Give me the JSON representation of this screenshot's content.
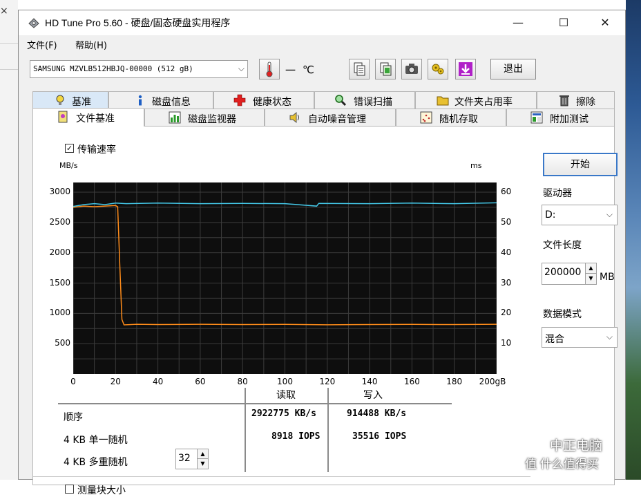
{
  "window": {
    "title": "HD Tune Pro 5.60 - 硬盘/固态硬盘实用程序",
    "minimize": "—",
    "maximize": "☐",
    "close": "✕"
  },
  "menu": [
    "文件(F)",
    "帮助(H)"
  ],
  "toolbar": {
    "drive": "SAMSUNG MZVLB512HBJQ-00000 (512 gB)",
    "temperature": "一",
    "exit_label": "退出",
    "icons": [
      "thermometer-icon",
      "copy-text-icon",
      "copy-screen-icon",
      "camera-icon",
      "options-icon",
      "save-download-icon"
    ]
  },
  "tabs_row1": [
    "基准",
    "磁盘信息",
    "健康状态",
    "错误扫描",
    "文件夹占用率",
    "擦除"
  ],
  "tabs_row2": [
    "文件基准",
    "磁盘监视器",
    "自动噪音管理",
    "随机存取",
    "附加测试"
  ],
  "active_tab": "文件基准",
  "benchmark": {
    "transfer_rate_label": "传输速率",
    "transfer_rate_checked": true,
    "block_size_label": "测量块大小",
    "block_size_checked": false
  },
  "chart_data": {
    "type": "line",
    "xlabel": "gB",
    "ylabel_left": "MB/s",
    "ylabel_right": "ms",
    "x_ticks": [
      0,
      20,
      40,
      60,
      80,
      100,
      120,
      140,
      160,
      180,
      200
    ],
    "x_tick_labels": [
      "0",
      "20",
      "40",
      "60",
      "80",
      "100",
      "120",
      "140",
      "160",
      "180",
      "200gB"
    ],
    "y_left_ticks": [
      500,
      1000,
      1500,
      2000,
      2500,
      3000
    ],
    "y_right_ticks": [
      10,
      20,
      30,
      40,
      50,
      60
    ],
    "xlim": [
      0,
      200
    ],
    "ylim_left": [
      0,
      3000
    ],
    "ylim_right": [
      0,
      60
    ],
    "grid": true,
    "series": [
      {
        "color": "#ff8c1a",
        "axis": "left",
        "points": [
          [
            0,
            2750
          ],
          [
            5,
            2770
          ],
          [
            10,
            2760
          ],
          [
            15,
            2770
          ],
          [
            20,
            2780
          ],
          [
            21,
            2760
          ],
          [
            22,
            1800
          ],
          [
            23,
            900
          ],
          [
            24,
            810
          ],
          [
            30,
            820
          ],
          [
            40,
            815
          ],
          [
            60,
            820
          ],
          [
            80,
            815
          ],
          [
            100,
            818
          ],
          [
            120,
            812
          ],
          [
            140,
            815
          ],
          [
            160,
            818
          ],
          [
            180,
            815
          ],
          [
            200,
            820
          ]
        ]
      },
      {
        "color": "#44c8e8",
        "axis": "right",
        "points": [
          [
            0,
            55.3
          ],
          [
            5,
            55.9
          ],
          [
            10,
            56.2
          ],
          [
            15,
            55.9
          ],
          [
            20,
            56.4
          ],
          [
            25,
            56.2
          ],
          [
            40,
            56.4
          ],
          [
            60,
            56.2
          ],
          [
            80,
            56.3
          ],
          [
            100,
            56.2
          ],
          [
            115,
            55.4
          ],
          [
            116,
            56.3
          ],
          [
            140,
            56.2
          ],
          [
            160,
            56.4
          ],
          [
            180,
            56.2
          ],
          [
            200,
            56.5
          ]
        ]
      }
    ]
  },
  "results": {
    "col_read": "读取",
    "col_write": "写入",
    "rows": [
      {
        "label": "顺序",
        "read": "2922775 KB/s",
        "write": "914488 KB/s"
      },
      {
        "label": "4 KB 单一随机",
        "read": "8918 IOPS",
        "write": "35516 IOPS"
      },
      {
        "label": "4 KB 多重随机",
        "read": "",
        "write": "",
        "queue": "32"
      }
    ]
  },
  "side": {
    "start_label": "开始",
    "drive_label": "驱动器",
    "drive_value": "D:",
    "length_label": "文件长度",
    "length_value": "200000",
    "length_unit": "MB",
    "mode_label": "数据模式",
    "mode_value": "混合"
  },
  "watermark": {
    "line1": "中正电脑",
    "line2": "值 什么值得买"
  }
}
